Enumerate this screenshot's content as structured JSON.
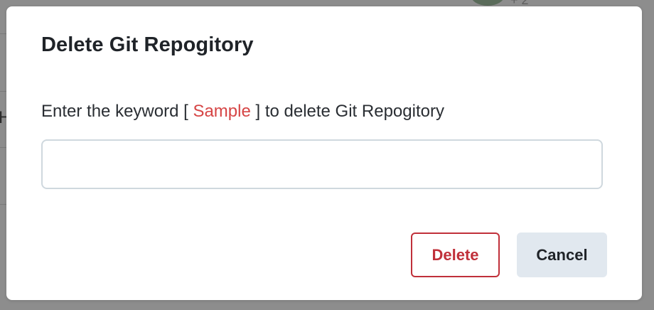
{
  "backdrop": {
    "more_text": "+ 2",
    "letter": "H"
  },
  "dialog": {
    "title": "Delete Git Repogitory",
    "prompt": {
      "prefix": "Enter the keyword [ ",
      "keyword": "Sample",
      "suffix": " ] to delete Git Repogitory"
    },
    "input": {
      "value": "",
      "placeholder": ""
    },
    "buttons": {
      "delete_label": "Delete",
      "cancel_label": "Cancel"
    }
  },
  "colors": {
    "keyword": "#d64545",
    "danger": "#c0303a",
    "secondary_bg": "#e1e8ef"
  }
}
